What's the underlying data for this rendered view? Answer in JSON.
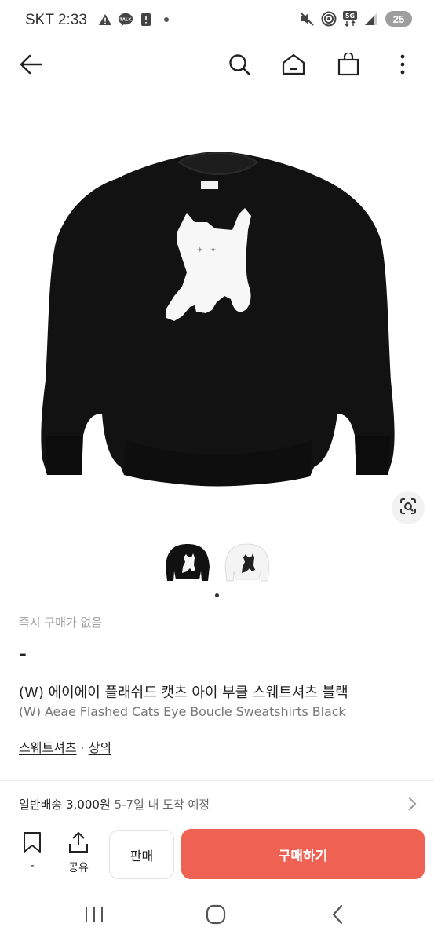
{
  "status_bar": {
    "carrier": "SKT",
    "time": "2:33",
    "talk_badge": "TALK",
    "network": "5G",
    "battery": "25"
  },
  "top_nav": {
    "icons": [
      "back-arrow-icon",
      "search-icon",
      "home-icon",
      "shopping-bag-icon",
      "more-vertical-icon"
    ]
  },
  "product": {
    "thumbnails": [
      {
        "name": "black sweatshirt",
        "color": "#111111"
      },
      {
        "name": "white sweatshirt",
        "color": "#f4f4f4"
      }
    ],
    "instant_buy_status": "즉시 구매가 없음",
    "price": "-",
    "title_ko": "(W) 에이에이 플래쉬드 캣츠 아이 부클 스웨트셔츠 블랙",
    "title_en": "(W) Aeae Flashed Cats Eye Boucle Sweatshirts Black",
    "categories": [
      "스웨트셔츠",
      "상의"
    ],
    "category_separator": "·"
  },
  "shipping": {
    "label": "일반배송 3,000원",
    "eta": "5-7일 내 도착 예정"
  },
  "bottom_bar": {
    "bookmark_count": "-",
    "share_label": "공유",
    "sell_label": "판매",
    "buy_label": "구매하기",
    "buy_color": "#ef6253"
  }
}
